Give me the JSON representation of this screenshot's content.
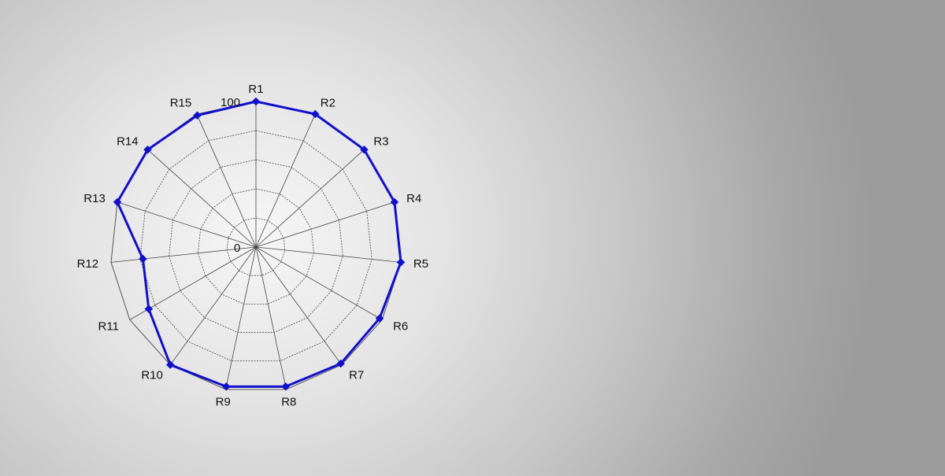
{
  "chart_data": {
    "type": "radar",
    "categories": [
      "R1",
      "R2",
      "R3",
      "R4",
      "R5",
      "R6",
      "R7",
      "R8",
      "R9",
      "R10",
      "R11",
      "R12",
      "R13",
      "R14",
      "R15"
    ],
    "series": [
      {
        "values": [
          100,
          100,
          100,
          100,
          100,
          98,
          99,
          98,
          98,
          100,
          85,
          78,
          100,
          100,
          99
        ],
        "color": "#1010cc"
      }
    ],
    "rlim": [
      0,
      100
    ],
    "radial_tick_labels": [
      "0",
      "100"
    ],
    "gridlines": 5,
    "grid": true,
    "legend": "none"
  }
}
